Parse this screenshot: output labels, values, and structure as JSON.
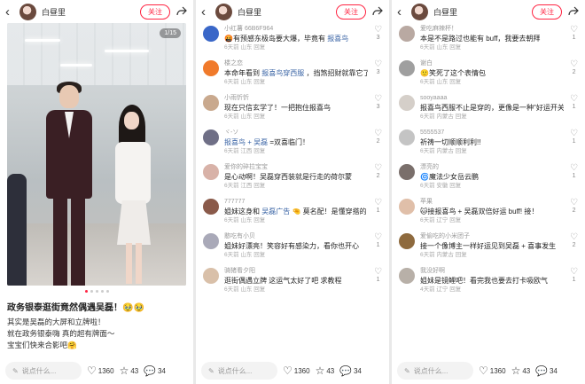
{
  "author": {
    "name": "白昼里",
    "follow_label": "关注"
  },
  "post": {
    "image_counter": "1/15",
    "title": "政务银泰逛街竟然偶遇吴磊！🥹🥹",
    "body": "其实是吴磊的大屏和立牌啦！\n就在政务银泰嗨 真的超有牌面～\n宝宝们快来合影吧🤗"
  },
  "bottom_bar": {
    "comment_placeholder": "说点什么...",
    "likes": "1360",
    "stars": "43",
    "comments": "34"
  },
  "panel2_comments": [
    {
      "user": "小红薯 66B6F964",
      "text": "🤬有预感东极岛要大爆，毕竟有 报喜鸟",
      "tag": "报喜鸟",
      "meta": "6天前 山东 回复",
      "likes": "3",
      "avatar_color": "#3a67c8"
    },
    {
      "user": "楼之恋",
      "text": "本命年看到 报喜鸟穿西服 ，挡煞招财就靠它了！",
      "tag": "报喜鸟穿西服",
      "meta": "6天前 山东 回复",
      "likes": "3",
      "avatar_color": "#f07a2b"
    },
    {
      "user": "小雨忻忻",
      "text": "现在只信玄学了！一把抱住报喜鸟",
      "tag": "",
      "meta": "6天前 山东 回复",
      "likes": "3",
      "avatar_color": "#c9a98e"
    },
    {
      "user": "ヾ-ソ",
      "text": "报喜鸟 + 吴磊 =双喜临门！",
      "tag": "报喜鸟 + 吴磊",
      "meta": "6天前 江西 回复",
      "likes": "2",
      "avatar_color": "#6f6f86"
    },
    {
      "user": "爱你的碎拉宝宝",
      "text": "是心动啊！吴磊穿西装就是行走的荷尔蒙",
      "tag": "",
      "meta": "6天前 江西 回复",
      "likes": "2",
      "avatar_color": "#d8b2a8"
    },
    {
      "user": "777777",
      "text": "姐妹这身和 吴磊广告 🤏 莫名配！是懂穿搭的",
      "tag": "吴磊广告",
      "meta": "6天前 山东 回复",
      "likes": "1",
      "avatar_color": "#8a5a4a"
    },
    {
      "user": "憨吃有小贝",
      "text": "姐妹好漂亮！笑容好有感染力，看你也开心",
      "tag": "",
      "meta": "6天前 山东 回复",
      "likes": "1",
      "avatar_color": "#a9a9b8"
    },
    {
      "user": "骑猪看夕阳",
      "text": "逛街偶遇立牌 这运气太好了吧 求教程",
      "tag": "",
      "meta": "6天前 山东 回复",
      "likes": "1",
      "avatar_color": "#d9c0a9"
    }
  ],
  "panel3_comments": [
    {
      "user": "爱吃麻辣杯！",
      "text": "本是不是路过也能有 buff，我要去朝拜",
      "tag": "",
      "meta": "6天前 山东 回复",
      "likes": "1",
      "avatar_color": "#b9a9a2"
    },
    {
      "user": "谢白",
      "text": "🙂笑死了这个表情包",
      "tag": "",
      "meta": "6天前 山东 回复",
      "likes": "2",
      "avatar_color": "#9f9f9f"
    },
    {
      "user": "sooyaaaa",
      "text": "报喜鸟西服不止是穿的，更像是一种\"好运开关\"🎌",
      "tag": "",
      "meta": "6天前 内蒙古 回复",
      "likes": "1",
      "avatar_color": "#d5cfc9"
    },
    {
      "user": "5555537",
      "text": "祈祷一切顺顺利利!!",
      "tag": "",
      "meta": "6天前 内蒙古 回复",
      "likes": "1",
      "avatar_color": "#c4c4c4"
    },
    {
      "user": "漂亮的",
      "text": "🌀魔法少女岳云鹏",
      "tag": "",
      "meta": "6天前 安徽 回复",
      "likes": "1",
      "avatar_color": "#7a6f6b"
    },
    {
      "user": "苹果",
      "text": "🐱接报喜鸟 + 吴磊双倍好运 buff! 接！",
      "tag": "",
      "meta": "6天前 辽宁 回复",
      "likes": "2",
      "avatar_color": "#e0bfa9"
    },
    {
      "user": "爱偷吃的小米团子",
      "text": "接一个像博主一样好运见到吴磊 + 喜事发生",
      "tag": "",
      "meta": "6天前 内蒙古 回复",
      "likes": "2",
      "avatar_color": "#8e6a3e"
    },
    {
      "user": "我没好啊",
      "text": "姐妹是镜鲤吧！看完我也要去打卡吸欧气",
      "tag": "",
      "meta": "4天前 辽宁 回复",
      "likes": "1",
      "avatar_color": "#b8b0a8"
    }
  ]
}
